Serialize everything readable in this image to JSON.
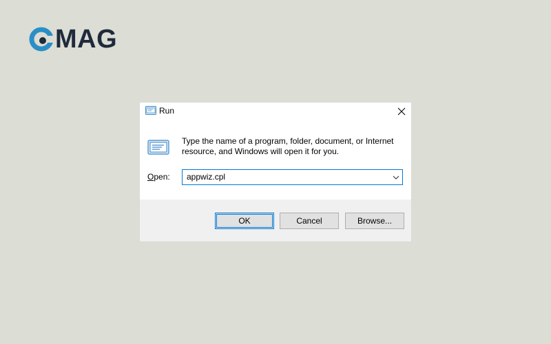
{
  "logo": {
    "text": "MAG",
    "icon": "cmag-logo-mark",
    "colors": {
      "ring": "#2a8fc6",
      "dot": "#1f2a3c",
      "text": "#1f2a3c"
    }
  },
  "dialog": {
    "title": "Run",
    "title_icon": "run-icon",
    "close_icon": "close-icon",
    "description": "Type the name of a program, folder, document, or Internet resource, and Windows will open it for you.",
    "open_label_prefix": "",
    "open_label_access": "O",
    "open_label_rest": "pen:",
    "input_value": "appwiz.cpl",
    "dropdown_icon": "chevron-down-icon",
    "buttons": {
      "ok": "OK",
      "cancel": "Cancel",
      "browse": "Browse..."
    },
    "accent": "#0078d7"
  }
}
